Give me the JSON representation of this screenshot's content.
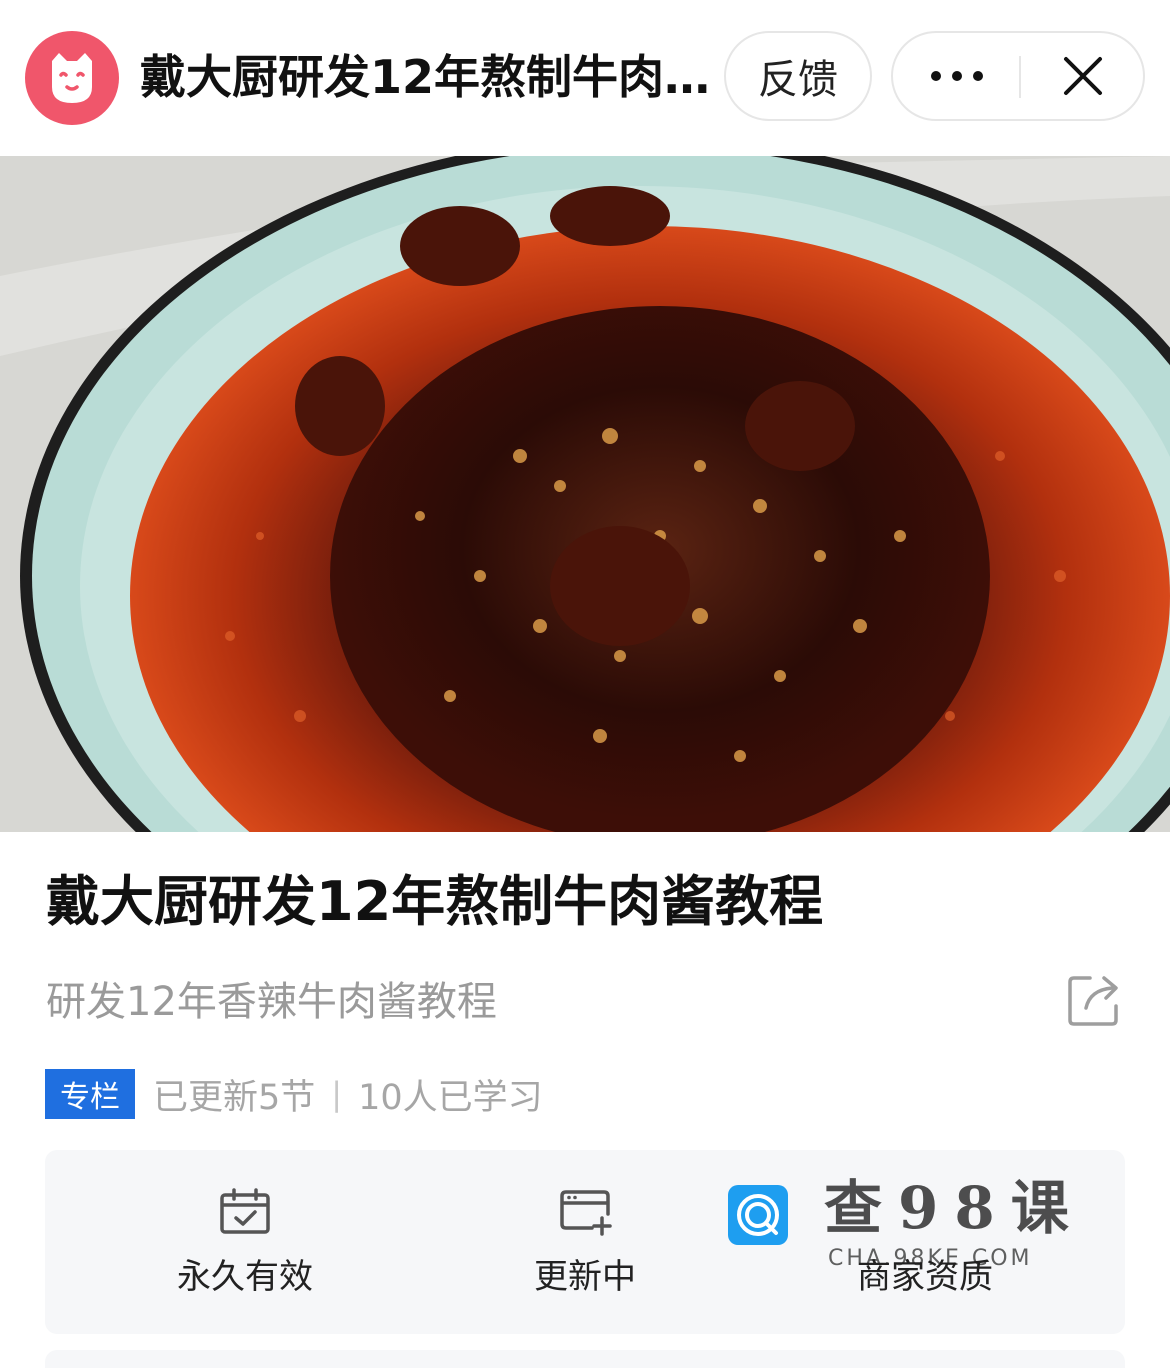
{
  "top_bar": {
    "title": "戴大厨研发12年熬制牛肉酱教程",
    "feedback_label": "反馈",
    "logo_icon": "cat-face-logo-icon",
    "more_icon": "more-dots-icon",
    "close_icon": "close-icon"
  },
  "hero": {
    "image_icon": "beef-sauce-bowl-photo"
  },
  "course": {
    "title": "戴大厨研发12年熬制牛肉酱教程",
    "subtitle": "研发12年香辣牛肉酱教程",
    "share_icon": "share-icon",
    "badge": "专栏",
    "updated": "已更新5节",
    "separator": "|",
    "learners": "10人已学习"
  },
  "features": [
    {
      "label": "永久有效",
      "icon": "calendar-check-icon"
    },
    {
      "label": "更新中",
      "icon": "window-plus-icon"
    },
    {
      "label": "商家资质",
      "icon": "merchant-qualification-icon"
    }
  ],
  "watermark": {
    "text": "查98课",
    "url": "CHA.98KE.COM"
  },
  "colors": {
    "logo": "#f0566b",
    "badge": "#1f6fe0",
    "card_bg": "#f6f7f9",
    "muted_text": "#9a9a9a"
  }
}
